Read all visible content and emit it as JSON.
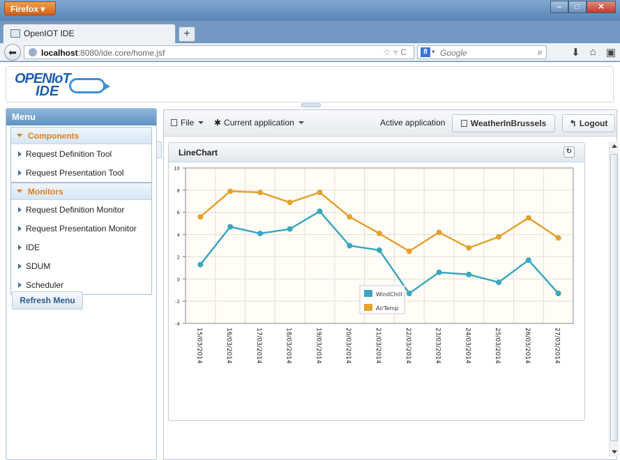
{
  "browser": {
    "menu_button": "Firefox",
    "tab_title": "OpenIOT IDE",
    "new_tab": "+",
    "url_host": "localhost",
    "url_rest": ":8080/ide.core/home.jsf",
    "search_placeholder": "Google"
  },
  "logo": {
    "line1": "OPENIoT",
    "line2": "IDE"
  },
  "menu": {
    "title": "Menu",
    "sections": [
      {
        "label": "Components",
        "items": [
          "Request Definition Tool",
          "Request Presentation Tool"
        ]
      },
      {
        "label": "Monitors",
        "items": [
          "Request Definition Monitor",
          "Request Presentation Monitor",
          "IDE",
          "SDUM",
          "Scheduler"
        ]
      }
    ],
    "refresh": "Refresh Menu"
  },
  "toolbar": {
    "file": "File",
    "current_app": "Current application",
    "active_label": "Active application",
    "active_app": "WeatherInBrussels",
    "logout": "Logout"
  },
  "chart_panel": {
    "title": "LineChart"
  },
  "colors": {
    "windchill": "#3aa7bd",
    "airtemp": "#e6a12e"
  },
  "chart_data": {
    "type": "line",
    "title": "",
    "xlabel": "",
    "ylabel": "",
    "categories": [
      "15/03/2014",
      "16/03/2014",
      "17/03/2014",
      "18/03/2014",
      "19/03/2014",
      "20/03/2014",
      "21/03/2014",
      "22/03/2014",
      "23/03/2014",
      "24/03/2014",
      "25/03/2014",
      "26/03/2014",
      "27/03/2014"
    ],
    "series": [
      {
        "name": "WindChill",
        "values": [
          1.3,
          4.7,
          4.1,
          4.5,
          6.1,
          3.0,
          2.6,
          -1.3,
          0.6,
          0.4,
          -0.3,
          1.7,
          -1.3
        ]
      },
      {
        "name": "AirTemp",
        "values": [
          5.6,
          7.9,
          7.8,
          6.9,
          7.8,
          5.6,
          4.1,
          2.5,
          4.2,
          2.8,
          3.8,
          5.5,
          3.7
        ]
      }
    ],
    "ylim": [
      -4,
      10
    ],
    "yticks": [
      -4,
      -2,
      0,
      2,
      4,
      6,
      8,
      10
    ],
    "grid": true,
    "legend": "center-bottom"
  }
}
